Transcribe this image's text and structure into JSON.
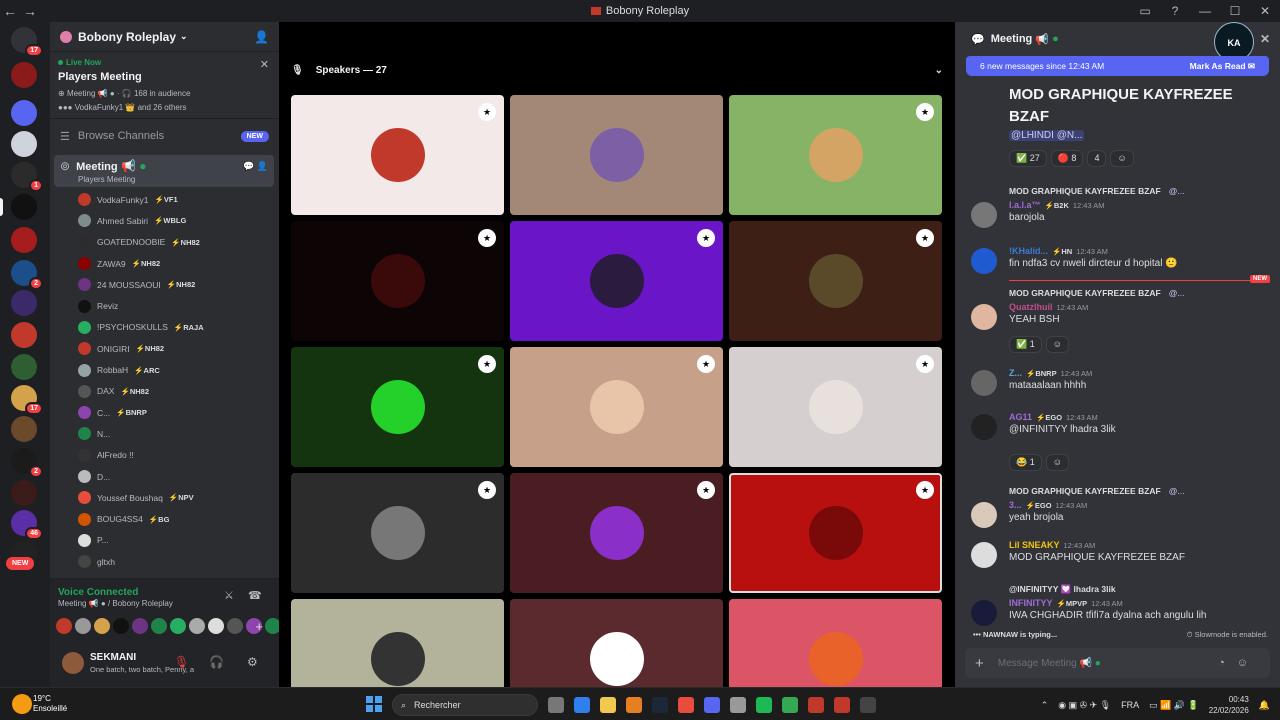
{
  "window": {
    "title": "Bobony Roleplay"
  },
  "server": {
    "name": "Bobony Roleplay"
  },
  "live": {
    "label": "Live Now",
    "title": "Players Meeting",
    "meta_channel": "Meeting",
    "audience": "168 in audience",
    "speakers_text": "VodkaFunky1",
    "others": "and 26 others"
  },
  "browse": {
    "label": "Browse Channels",
    "badge": "NEW"
  },
  "stage_channel": {
    "name": "Meeting",
    "subtitle": "Players Meeting"
  },
  "members": [
    {
      "name": "VodkaFunky1",
      "tag": "VF1",
      "color": "#c0392b"
    },
    {
      "name": "Ahmed Sabiri",
      "tag": "WBLG",
      "color": "#7f8c8d"
    },
    {
      "name": "GOATEDNOOBIE",
      "tag": "NH82",
      "color": "#2c2c2c"
    },
    {
      "name": "ZAWA9",
      "tag": "NH82",
      "color": "#8b0000"
    },
    {
      "name": "24 MOUSSAOUI",
      "tag": "NH82",
      "color": "#6c3483"
    },
    {
      "name": "Reviz",
      "tag": "",
      "color": "#111"
    },
    {
      "name": "!PSYCHOSKULLS",
      "tag": "RAJA",
      "color": "#27ae60"
    },
    {
      "name": "ONIGIRI",
      "tag": "NH82",
      "color": "#c0392b"
    },
    {
      "name": "RobbaH",
      "tag": "ARC",
      "color": "#95a5a6"
    },
    {
      "name": "DAX",
      "tag": "NH82",
      "color": "#555"
    },
    {
      "name": "C...",
      "tag": "BNRP",
      "color": "#8e44ad"
    },
    {
      "name": "N...",
      "tag": "",
      "color": "#1e8449"
    },
    {
      "name": "AlFredo !!",
      "tag": "",
      "color": "#333"
    },
    {
      "name": "D...",
      "tag": "",
      "color": "#bbb"
    },
    {
      "name": "Youssef Boushaq",
      "tag": "NPV",
      "color": "#e74c3c"
    },
    {
      "name": "BOUG4SS4",
      "tag": "BG",
      "color": "#d35400"
    },
    {
      "name": "P...",
      "tag": "",
      "color": "#ddd"
    },
    {
      "name": "gltxh",
      "tag": "",
      "color": "#444"
    }
  ],
  "voice": {
    "status": "Voice Connected",
    "channel": "Meeting",
    "server": "/ Bobony Roleplay"
  },
  "user": {
    "name": "SEKMANI",
    "status": "One batch, two batch, Penny, a"
  },
  "stage": {
    "speakers_label": "Speakers — 27"
  },
  "tiles": [
    {
      "bg": "#f3e9e9",
      "av": "#c0392b",
      "mod": true
    },
    {
      "bg": "#a38877",
      "av": "#7d5fa6",
      "mod": false
    },
    {
      "bg": "#86b366",
      "av": "#d3a463",
      "mod": true
    },
    {
      "bg": "#0c0405",
      "av": "#3a0a0a",
      "mod": true
    },
    {
      "bg": "#6a16c8",
      "av": "#2b1b3f",
      "mod": true
    },
    {
      "bg": "#3d1f16",
      "av": "#5a4a2a",
      "mod": true
    },
    {
      "bg": "#14340f",
      "av": "#24d12a",
      "mod": true
    },
    {
      "bg": "#c7a089",
      "av": "#e8c4a8",
      "mod": true
    },
    {
      "bg": "#d6cfcf",
      "av": "#e8e0dd",
      "mod": true
    },
    {
      "bg": "#2c2c2c",
      "av": "#777",
      "mod": true
    },
    {
      "bg": "#4a1d22",
      "av": "#8a2fc8",
      "mod": true
    },
    {
      "bg": "#b80f0f",
      "av": "#7a0a0a",
      "mod": true,
      "selected": true
    },
    {
      "bg": "#b3b39b",
      "av": "#333",
      "mod": false
    },
    {
      "bg": "#5a2a2e",
      "av": "#fff",
      "mod": false
    },
    {
      "bg": "#dc5566",
      "av": "#e8622a",
      "mod": false
    }
  ],
  "chat": {
    "channel": "Meeting",
    "brand": "KA",
    "new_messages": "6 new messages since 12:43 AM",
    "mark_read": "Mark As Read",
    "big_title": "MOD GRAPHIQUE KAYFREZEE BZAF",
    "mentions": "@LHINDI @N...",
    "top_reacts": [
      "✅ 27",
      "🔴 8",
      "4",
      "☺"
    ],
    "messages": [
      {
        "reply_text": "MOD GRAPHIQUE KAYFREZEE BZAF",
        "reply_mention": "@...",
        "name": "l.a.l.a™",
        "tag": "B2K",
        "time": "12:43 AM",
        "text": "barojola",
        "name_color": "#a06bd6",
        "av": "#777"
      },
      {
        "reply_text": "",
        "reply_mention": "",
        "name": "!KHalid...",
        "tag": "HN",
        "time": "12:43 AM",
        "text": "fin ndfa3 cv nweli dircteur d hopital 🙂",
        "name_color": "#3b7bd4",
        "av": "#1e5bd1"
      },
      {
        "reply_text": "MOD GRAPHIQUE KAYFREZEE BZAF",
        "reply_mention": "@...",
        "name": "Quatzlhuil",
        "tag": "",
        "time": "12:43 AM",
        "text": "YEAH BSH",
        "name_color": "#c24d8c",
        "av": "#e0b6a0"
      },
      {
        "reply_text": "",
        "reply_mention": "",
        "name": "Z...",
        "tag": "BNRP",
        "time": "12:43 AM",
        "text": "mataaalaan hhhh",
        "name_color": "#5aa8d6",
        "av": "#666"
      },
      {
        "reply_text": "",
        "reply_mention": "",
        "name": "AG11",
        "tag": "EGO",
        "time": "12:43 AM",
        "text": "@INFINITYY lhadra 3lik",
        "name_color": "#a06bd6",
        "av": "#222"
      },
      {
        "reply_text": "MOD GRAPHIQUE KAYFREZEE BZAF",
        "reply_mention": "@...",
        "name": "3...",
        "tag": "EGO",
        "time": "12:43 AM",
        "text": "yeah brojola",
        "name_color": "#a06bd6",
        "av": "#d9c9b8"
      },
      {
        "reply_text": "",
        "reply_mention": "",
        "name": "Lil SNEAKY",
        "tag": "",
        "time": "12:43 AM",
        "text": "MOD GRAPHIQUE KAYFREZEE BZAF",
        "name_color": "#f1c40f",
        "av": "#ddd"
      },
      {
        "reply_text": "@INFINITYY 💟 lhadra 3lik",
        "reply_mention": "",
        "name": "INFINITYY",
        "tag": "MPVP",
        "time": "12:43 AM",
        "text": "IWA CHGHADIR tfifi7a dyalna ach angulu lih",
        "name_color": "#a06bd6",
        "av": "#1a1a3a"
      }
    ],
    "react_1": "1",
    "typing": "NAWNAW is typing...",
    "slowmode": "Slowmode is enabled.",
    "placeholder": "Message Meeting"
  },
  "taskbar": {
    "temp": "19°C",
    "weather": "Ensoleillé",
    "search": "Rechercher",
    "lang": "FRA",
    "time": "00:43",
    "date": "22/02/2026"
  },
  "guild_badges": [
    "17",
    "1",
    "2",
    "17",
    "2",
    "46"
  ],
  "guild_new": "NEW",
  "colors": {
    "accent": "#5865f2",
    "green": "#23a55a",
    "red": "#f23f43"
  }
}
